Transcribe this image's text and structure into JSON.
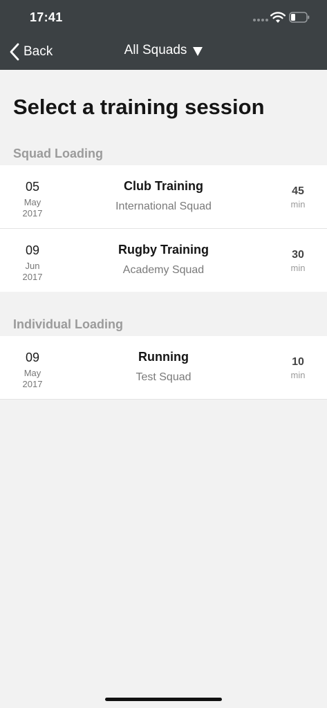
{
  "status_bar": {
    "time": "17:41"
  },
  "nav": {
    "back_label": "Back",
    "squad_filter_label": "All Squads"
  },
  "page": {
    "title": "Select a training session"
  },
  "sections": [
    {
      "header": "Squad Loading",
      "sessions": [
        {
          "day": "05",
          "month": "May",
          "year": "2017",
          "title": "Club Training",
          "squad": "International Squad",
          "duration": "45",
          "unit": "min"
        },
        {
          "day": "09",
          "month": "Jun",
          "year": "2017",
          "title": "Rugby Training",
          "squad": "Academy Squad",
          "duration": "30",
          "unit": "min"
        }
      ]
    },
    {
      "header": "Individual Loading",
      "sessions": [
        {
          "day": "09",
          "month": "May",
          "year": "2017",
          "title": "Running",
          "squad": "Test Squad",
          "duration": "10",
          "unit": "min"
        }
      ]
    }
  ],
  "colors": {
    "nav_background": "#3c4144",
    "page_background": "#f2f2f2",
    "section_header": "#9b9b9b"
  }
}
